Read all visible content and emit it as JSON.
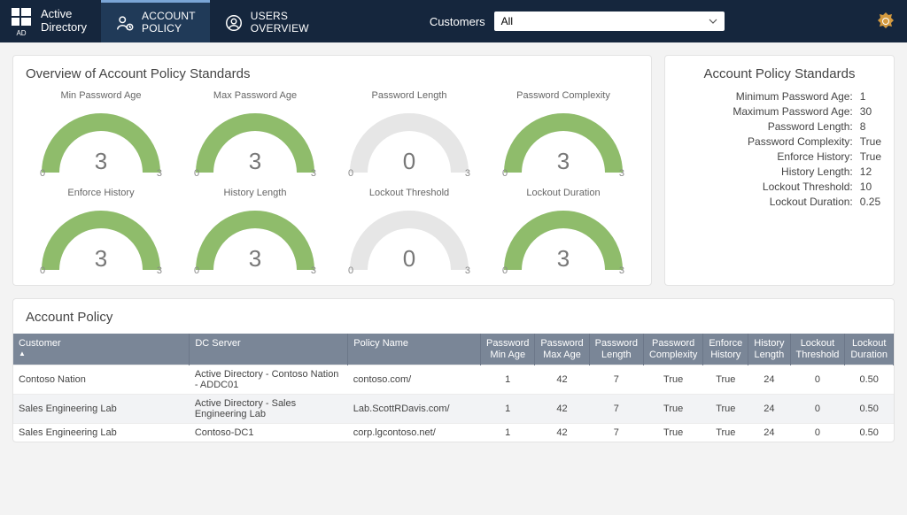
{
  "header": {
    "brand": {
      "line1": "Active",
      "line2": "Directory",
      "sub": "AD"
    },
    "tabs": {
      "account_policy": {
        "line1": "ACCOUNT",
        "line2": "POLICY"
      },
      "users_overview": {
        "line1": "USERS",
        "line2": "OVERVIEW"
      }
    },
    "customers_label": "Customers",
    "customers_value": "All"
  },
  "overview": {
    "title": "Overview of Account Policy Standards",
    "gauges": [
      {
        "label": "Min Password Age",
        "value": "3",
        "min": "0",
        "max": "3",
        "full": true
      },
      {
        "label": "Max Password Age",
        "value": "3",
        "min": "0",
        "max": "3",
        "full": true
      },
      {
        "label": "Password Length",
        "value": "0",
        "min": "0",
        "max": "3",
        "full": false
      },
      {
        "label": "Password Complexity",
        "value": "3",
        "min": "0",
        "max": "3",
        "full": true
      },
      {
        "label": "Enforce History",
        "value": "3",
        "min": "0",
        "max": "3",
        "full": true
      },
      {
        "label": "History Length",
        "value": "3",
        "min": "0",
        "max": "3",
        "full": true
      },
      {
        "label": "Lockout Threshold",
        "value": "0",
        "min": "0",
        "max": "3",
        "full": false
      },
      {
        "label": "Lockout Duration",
        "value": "3",
        "min": "0",
        "max": "3",
        "full": true
      }
    ]
  },
  "standards": {
    "title": "Account Policy Standards",
    "items": [
      {
        "key": "Minimum Password Age:",
        "value": "1"
      },
      {
        "key": "Maximum Password Age:",
        "value": "30"
      },
      {
        "key": "Password Length:",
        "value": "8"
      },
      {
        "key": "Password Complexity:",
        "value": "True"
      },
      {
        "key": "Enforce History:",
        "value": "True"
      },
      {
        "key": "History Length:",
        "value": "12"
      },
      {
        "key": "Lockout Threshold:",
        "value": "10"
      },
      {
        "key": "Lockout Duration:",
        "value": "0.25"
      }
    ]
  },
  "table": {
    "title": "Account Policy",
    "headers": {
      "customer": "Customer",
      "dc_server": "DC Server",
      "policy": "Policy Name",
      "min_age_1": "Password",
      "min_age_2": "Min Age",
      "max_age_1": "Password",
      "max_age_2": "Max Age",
      "length_1": "Password",
      "length_2": "Length",
      "complexity_1": "Password",
      "complexity_2": "Complexity",
      "enforce_1": "Enforce",
      "enforce_2": "History",
      "histlen_1": "History",
      "histlen_2": "Length",
      "lock_thr_1": "Lockout",
      "lock_thr_2": "Threshold",
      "lock_dur_1": "Lockout",
      "lock_dur_2": "Duration"
    },
    "rows": [
      {
        "customer": "Contoso Nation",
        "dc": "Active Directory - Contoso Nation - ADDC01",
        "policy": "contoso.com/",
        "min_age": "1",
        "max_age": "42",
        "length": "7",
        "complexity": "True",
        "enforce": "True",
        "histlen": "24",
        "lock_thr": "0",
        "lock_dur": "0.50"
      },
      {
        "customer": "Sales Engineering Lab",
        "dc": "Active Directory - Sales Engineering Lab",
        "policy": "Lab.ScottRDavis.com/",
        "min_age": "1",
        "max_age": "42",
        "length": "7",
        "complexity": "True",
        "enforce": "True",
        "histlen": "24",
        "lock_thr": "0",
        "lock_dur": "0.50"
      },
      {
        "customer": "Sales Engineering Lab",
        "dc": "Contoso-DC1",
        "policy": "corp.lgcontoso.net/",
        "min_age": "1",
        "max_age": "42",
        "length": "7",
        "complexity": "True",
        "enforce": "True",
        "histlen": "24",
        "lock_thr": "0",
        "lock_dur": "0.50"
      }
    ]
  }
}
